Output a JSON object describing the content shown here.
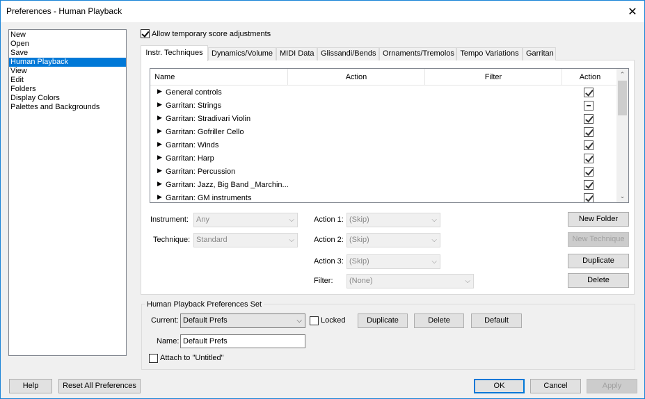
{
  "window": {
    "title": "Preferences - Human Playback",
    "close_glyph": "✕"
  },
  "categories": [
    "New",
    "Open",
    "Save",
    "Human Playback",
    "View",
    "Edit",
    "Folders",
    "Display Colors",
    "Palettes and Backgrounds"
  ],
  "allow_temp": {
    "label": "Allow temporary score adjustments",
    "checked": true
  },
  "tabs": [
    "Instr. Techniques",
    "Dynamics/Volume",
    "MIDI Data",
    "Glissandi/Bends",
    "Ornaments/Tremolos",
    "Tempo Variations",
    "Garritan"
  ],
  "grid": {
    "columns": [
      "Name",
      "Action",
      "Filter",
      "Action"
    ],
    "rows": [
      {
        "name": "General controls",
        "state": "checked"
      },
      {
        "name": "Garritan: Strings",
        "state": "indeterminate"
      },
      {
        "name": "Garritan: Stradivari Violin",
        "state": "checked"
      },
      {
        "name": "Garritan: Gofriller Cello",
        "state": "checked"
      },
      {
        "name": "Garritan: Winds",
        "state": "checked"
      },
      {
        "name": "Garritan: Harp",
        "state": "checked"
      },
      {
        "name": "Garritan: Percussion",
        "state": "checked"
      },
      {
        "name": "Garritan: Jazz, Big Band _Marchin...",
        "state": "checked"
      },
      {
        "name": "Garritan: GM instruments",
        "state": "checked"
      }
    ]
  },
  "form": {
    "instrument_label": "Instrument:",
    "instrument_value": "Any",
    "technique_label": "Technique:",
    "technique_value": "Standard",
    "action1_label": "Action 1:",
    "action1_value": "(Skip)",
    "action2_label": "Action 2:",
    "action2_value": "(Skip)",
    "action3_label": "Action 3:",
    "action3_value": "(Skip)",
    "filter_label": "Filter:",
    "filter_value": "(None)"
  },
  "panel_buttons": {
    "new_folder": "New Folder",
    "new_technique": "New Technique",
    "duplicate": "Duplicate",
    "delete": "Delete"
  },
  "prefs_set": {
    "title": "Human Playback Preferences Set",
    "current_label": "Current:",
    "current_value": "Default Prefs",
    "locked_label": "Locked",
    "duplicate": "Duplicate",
    "delete": "Delete",
    "default": "Default",
    "name_label": "Name:",
    "name_value": "Default Prefs",
    "attach_label": "Attach to \"Untitled\""
  },
  "footer": {
    "help": "Help",
    "reset": "Reset All Preferences",
    "ok": "OK",
    "cancel": "Cancel",
    "apply": "Apply"
  },
  "icons": {
    "expand": "▶",
    "dropdown": "⌵",
    "scroll_up": "⌃",
    "scroll_down": "⌄"
  }
}
